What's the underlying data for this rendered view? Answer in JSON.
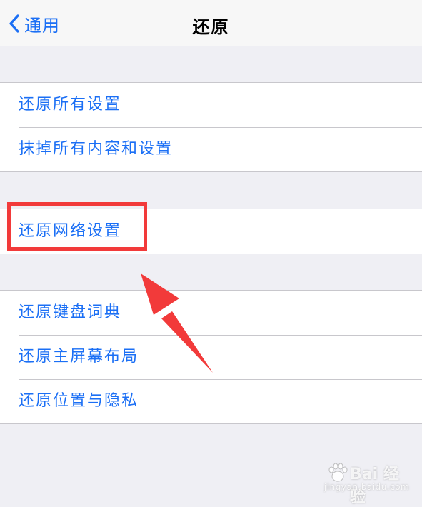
{
  "nav": {
    "back_label": "通用",
    "title": "还原"
  },
  "groups": [
    {
      "items": [
        "还原所有设置",
        "抹掉所有内容和设置"
      ]
    },
    {
      "items": [
        "还原网络设置"
      ]
    },
    {
      "items": [
        "还原键盘词典",
        "还原主屏幕布局",
        "还原位置与隐私"
      ]
    }
  ],
  "annotation": {
    "highlighted_item": "还原网络设置",
    "highlight_color": "#f23a3a",
    "arrow_color": "#f23a3a"
  },
  "watermark": {
    "brand": "Bai 经验",
    "url": "jingyan.baidu.com",
    "icon": "paw-icon"
  },
  "colors": {
    "accent": "#1b6ff5",
    "background": "#efeff4",
    "separator": "#c8c7cc"
  }
}
